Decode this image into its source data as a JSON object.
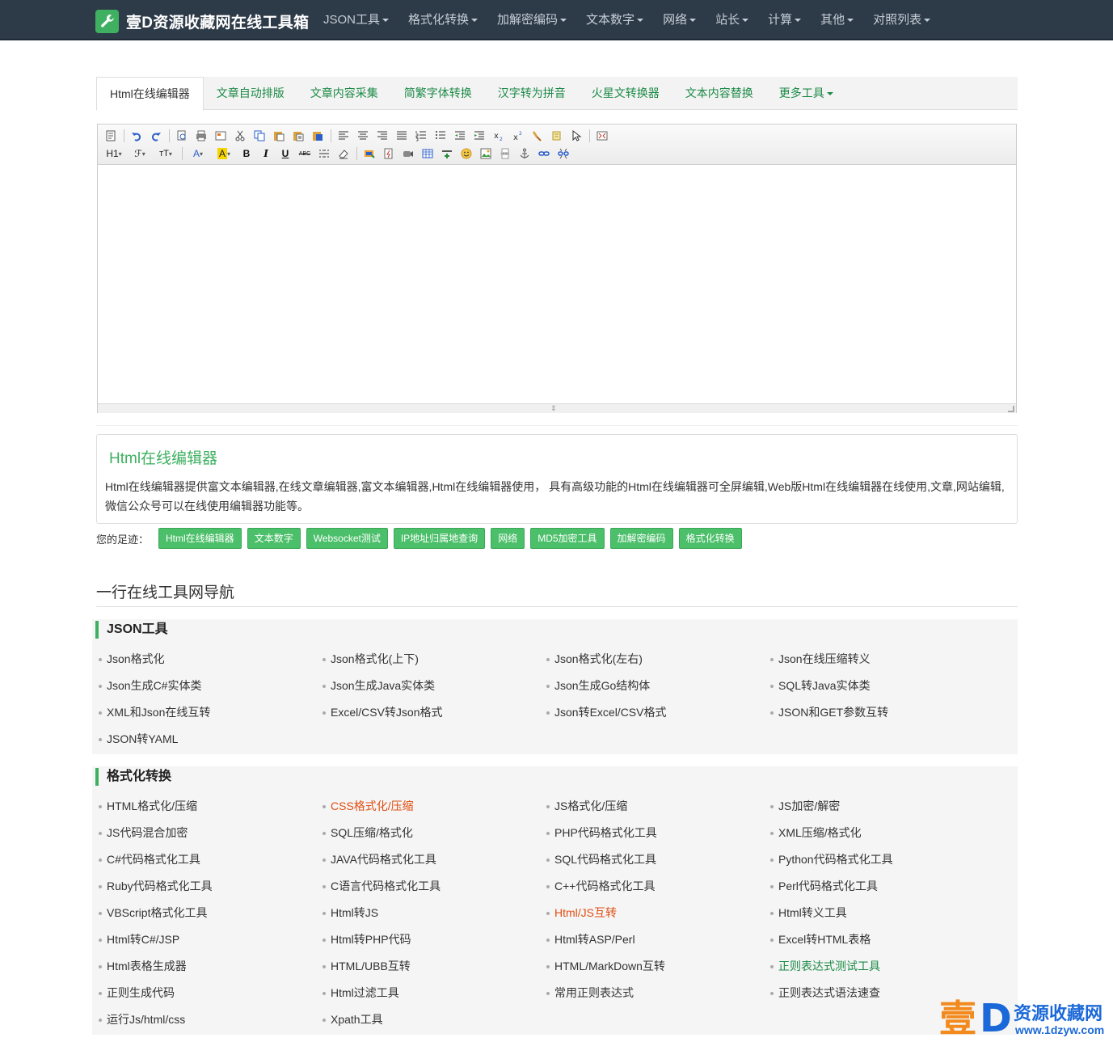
{
  "brand": {
    "title": "壹D资源收藏网在线工具箱",
    "logo_icon": "wrench-icon"
  },
  "nav": [
    {
      "label": "JSON工具"
    },
    {
      "label": "格式化转换"
    },
    {
      "label": "加解密编码"
    },
    {
      "label": "文本数字"
    },
    {
      "label": "网络"
    },
    {
      "label": "站长"
    },
    {
      "label": "计算"
    },
    {
      "label": "其他"
    },
    {
      "label": "对照列表"
    }
  ],
  "tabs": [
    {
      "label": "Html在线编辑器"
    },
    {
      "label": "文章自动排版"
    },
    {
      "label": "文章内容采集"
    },
    {
      "label": "简繁字体转换"
    },
    {
      "label": "汉字转为拼音"
    },
    {
      "label": "火星文转换器"
    },
    {
      "label": "文本内容替换"
    },
    {
      "label": "更多工具"
    }
  ],
  "toolbar": {
    "heading_btn": "H1",
    "font_family_btn": "ℱ",
    "font_size_btn": "тT",
    "font_color_btn": "A",
    "highlight_btn": "A",
    "bold_btn": "B",
    "italic_btn": "I",
    "underline_btn": "U",
    "strike_btn": "ABC"
  },
  "description": {
    "title": "Html在线编辑器",
    "text": "Html在线编辑器提供富文本编辑器,在线文章编辑器,富文本编辑器,Html在线编辑器使用，  具有高级功能的Html在线编辑器可全屏编辑,Web版Html在线编辑器在线使用,文章,网站编辑,微信公众号可以在线使用编辑器功能等。"
  },
  "footprints": {
    "label": "您的足迹：",
    "tags": [
      "Html在线编辑器",
      "文本数字",
      "Websocket测试",
      "IP地址归属地查询",
      "网络",
      "MD5加密工具",
      "加解密编码",
      "格式化转换"
    ]
  },
  "nav_section": {
    "heading": "一行在线工具网导航",
    "groups": [
      {
        "title": "JSON工具",
        "items": [
          "Json格式化",
          " Json格式化(上下)",
          "Json格式化(左右)",
          "Json在线压缩转义",
          "Json生成C#实体类",
          " Json生成Java实体类",
          "Json生成Go结构体",
          "SQL转Java实体类",
          "XML和Json在线互转",
          "Excel/CSV转Json格式",
          "Json转Excel/CSV格式",
          "JSON和GET参数互转",
          "JSON转YAML"
        ]
      },
      {
        "title": "格式化转换",
        "items": [
          "HTML格式化/压缩",
          " CSS格式化/压缩",
          "JS格式化/压缩",
          "JS加密/解密",
          " JS代码混合加密",
          "SQL压缩/格式化",
          "PHP代码格式化工具",
          "XML压缩/格式化",
          "C#代码格式化工具",
          "JAVA代码格式化工具",
          "SQL代码格式化工具",
          "Python代码格式化工具",
          "Ruby代码格式化工具",
          "C语言代码格式化工具",
          "C++代码格式化工具",
          "Perl代码格式化工具",
          "VBScript格式化工具",
          " Html转JS",
          "Html/JS互转",
          " Html转义工具",
          " Html转C#/JSP",
          "Html转PHP代码",
          "Html转ASP/Perl",
          "Excel转HTML表格",
          "Html表格生成器",
          "HTML/UBB互转",
          "HTML/MarkDown互转",
          "正则表达式测试工具",
          "正则生成代码",
          "Html过滤工具",
          "常用正则表达式",
          "正则表达式语法速查",
          "运行Js/html/css",
          "Xpath工具"
        ],
        "highlight_red": [
          1,
          18
        ],
        "highlight_green": [
          27
        ]
      }
    ]
  },
  "watermark": {
    "mark": "壹",
    "mark2": "D",
    "name": "资源收藏网",
    "url": "www.1dzyw.com"
  },
  "colors": {
    "navbar": "#2d3a48",
    "accent": "#3fb061",
    "link_green": "#1b8a46",
    "link_red": "#e04e12"
  }
}
